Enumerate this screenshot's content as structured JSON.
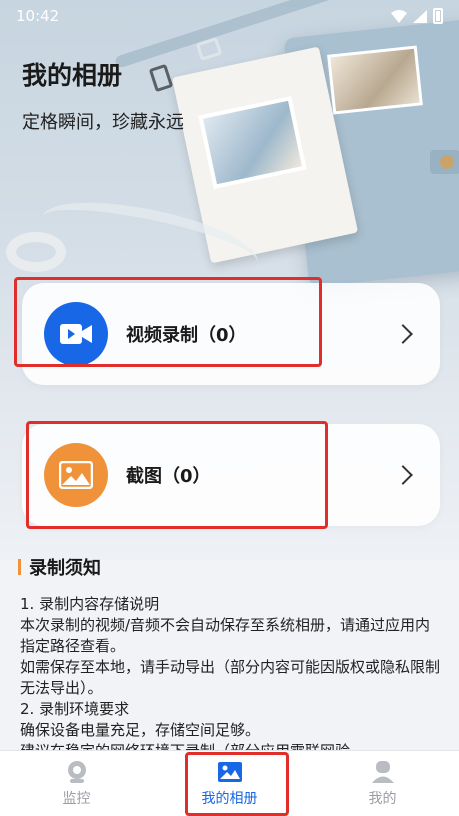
{
  "status_bar": {
    "time": "10:42"
  },
  "header": {
    "title": "我的相册",
    "subtitle": "定格瞬间，珍藏永远"
  },
  "cards": [
    {
      "label": "视频录制（0）",
      "icon": "video-icon",
      "color": "#1867e6"
    },
    {
      "label": "截图（0）",
      "icon": "image-icon",
      "color": "#f0923a"
    }
  ],
  "notice": {
    "heading": "录制须知",
    "lines": [
      "1. 录制内容存储说明",
      "本次录制的视频/音频不会自动保存至系统相册，请通过应用内指定路径查看。",
      "如需保存至本地，请手动导出（部分内容可能因版权或隐私限制无法导出）。",
      "2. 录制环境要求",
      "确保设备电量充足，存储空间足够。",
      "建议在稳定的网络环境下录制（部分应用需联网验"
    ]
  },
  "bottom_nav": [
    {
      "label": "监控",
      "icon": "camera-icon",
      "active": false
    },
    {
      "label": "我的相册",
      "icon": "album-icon",
      "active": true
    },
    {
      "label": "我的",
      "icon": "profile-icon",
      "active": false
    }
  ],
  "colors": {
    "accent": "#1867e6",
    "highlight": "#e02f2a",
    "orange": "#f0923a"
  }
}
